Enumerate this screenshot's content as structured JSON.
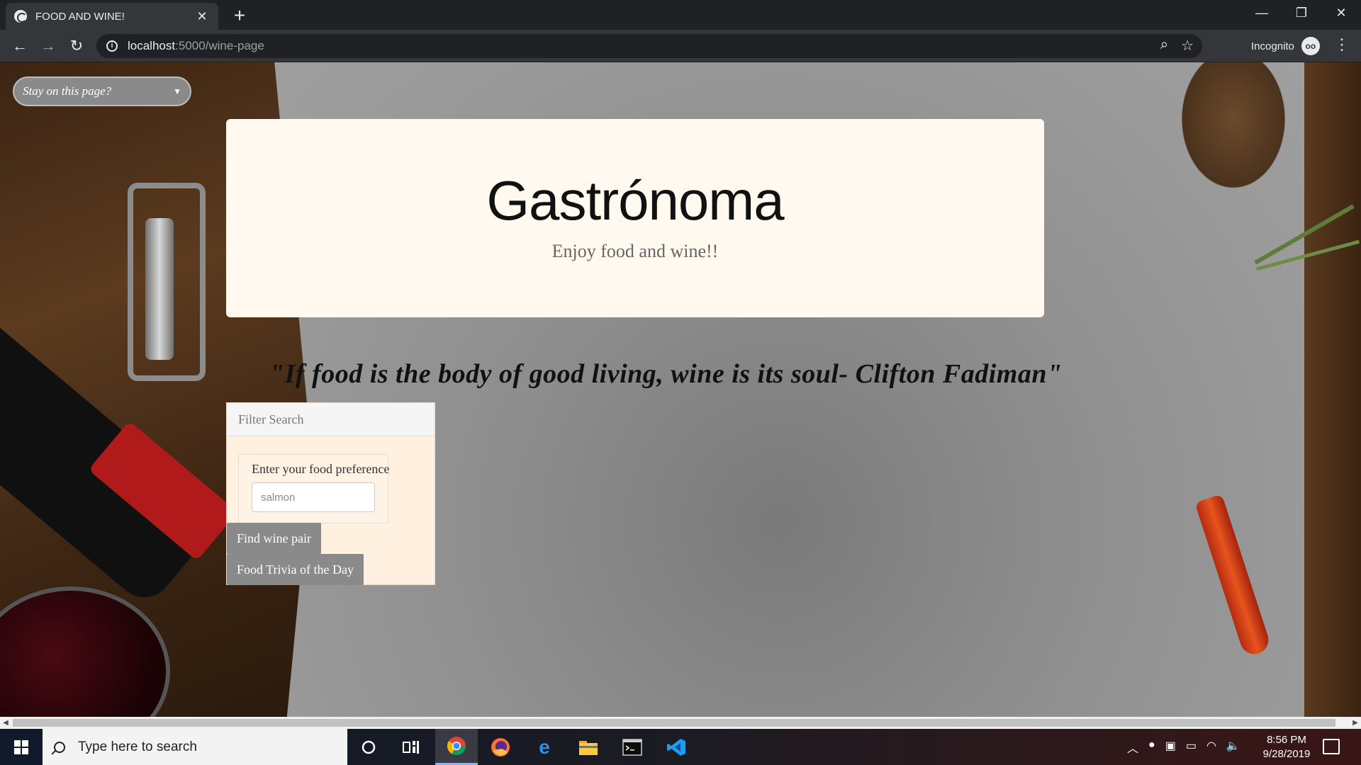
{
  "browser": {
    "tab_title": "FOOD AND WINE!",
    "tab_close": "✕",
    "new_tab": "+",
    "url_host": "localhost",
    "url_path": ":5000/wine-page",
    "incognito_label": "Incognito",
    "window_controls": {
      "minimize": "—",
      "restore": "❐",
      "close": "✕"
    },
    "nav": {
      "back": "←",
      "forward": "→",
      "reload": "↻"
    }
  },
  "page": {
    "stay_select": {
      "selected": "Stay on this page?"
    },
    "hero": {
      "title": "Gastrónoma",
      "subtitle": "Enjoy food and wine!!"
    },
    "quote": "\"If food is the body of good living, wine is its soul- Clifton Fadiman\"",
    "filter": {
      "heading": "Filter Search",
      "pref_label": "Enter your food preference",
      "pref_value": "salmon",
      "find_button": "Find wine pair",
      "trivia_button": "Food Trivia of the Day"
    }
  },
  "taskbar": {
    "search_placeholder": "Type here to search",
    "time": "8:56 PM",
    "date": "9/28/2019"
  }
}
